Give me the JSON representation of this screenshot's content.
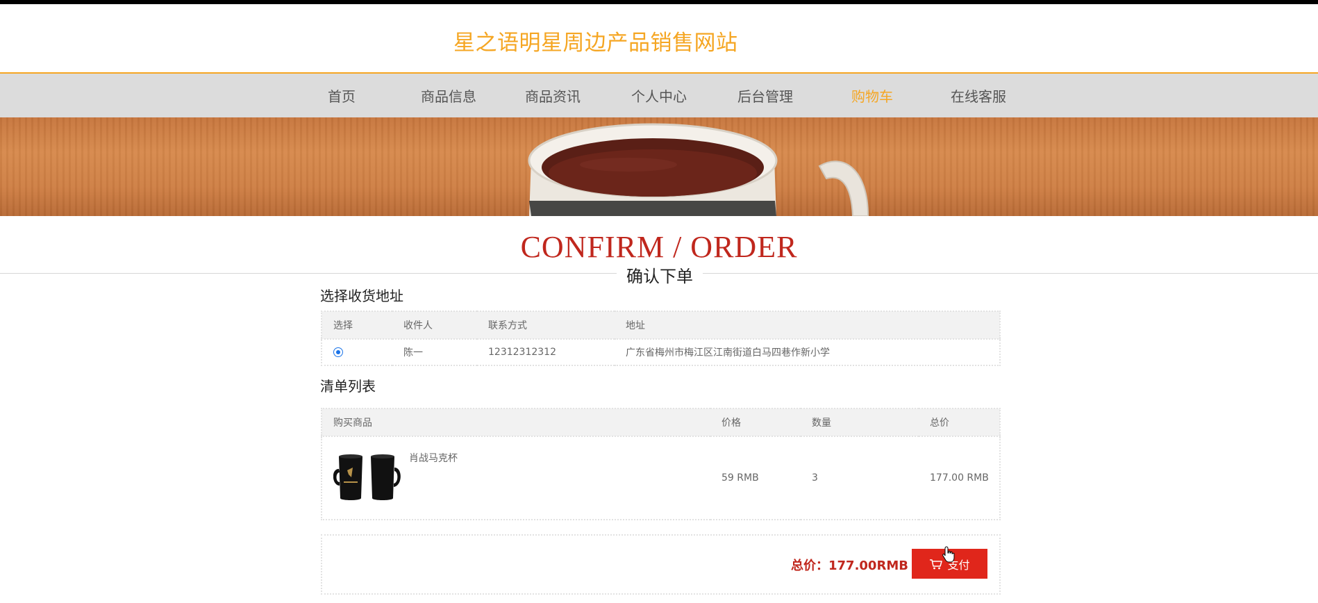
{
  "site": {
    "title": "星之语明星周边产品销售网站"
  },
  "nav": {
    "items": [
      {
        "label": "首页"
      },
      {
        "label": "商品信息"
      },
      {
        "label": "商品资讯"
      },
      {
        "label": "个人中心"
      },
      {
        "label": "后台管理"
      },
      {
        "label": "购物车"
      },
      {
        "label": "在线客服"
      }
    ],
    "active": "购物车"
  },
  "section": {
    "title_en": "CONFIRM / ORDER",
    "title_cn": "确认下单"
  },
  "address": {
    "heading": "选择收货地址",
    "headers": [
      "选择",
      "收件人",
      "联系方式",
      "地址"
    ],
    "rows": [
      {
        "selected": true,
        "recipient": "陈一",
        "phone": "12312312312",
        "address": "广东省梅州市梅江区江南街道白马四巷作新小学"
      }
    ]
  },
  "items": {
    "heading": "清单列表",
    "headers": [
      "购买商品",
      "价格",
      "数量",
      "总价"
    ],
    "rows": [
      {
        "name": "肖战马克杯",
        "image": "mug-product-image",
        "price": "59 RMB",
        "quantity": "3",
        "total": "177.00 RMB"
      }
    ]
  },
  "summary": {
    "total_label": "总价：177.00RMB",
    "pay_label": "支付",
    "pay_icon": "cart-icon"
  },
  "colors": {
    "brand": "#f5a623",
    "accent_red": "#c0271d",
    "pay_red": "#e0261b",
    "nav_bg": "#dcdcdc"
  }
}
